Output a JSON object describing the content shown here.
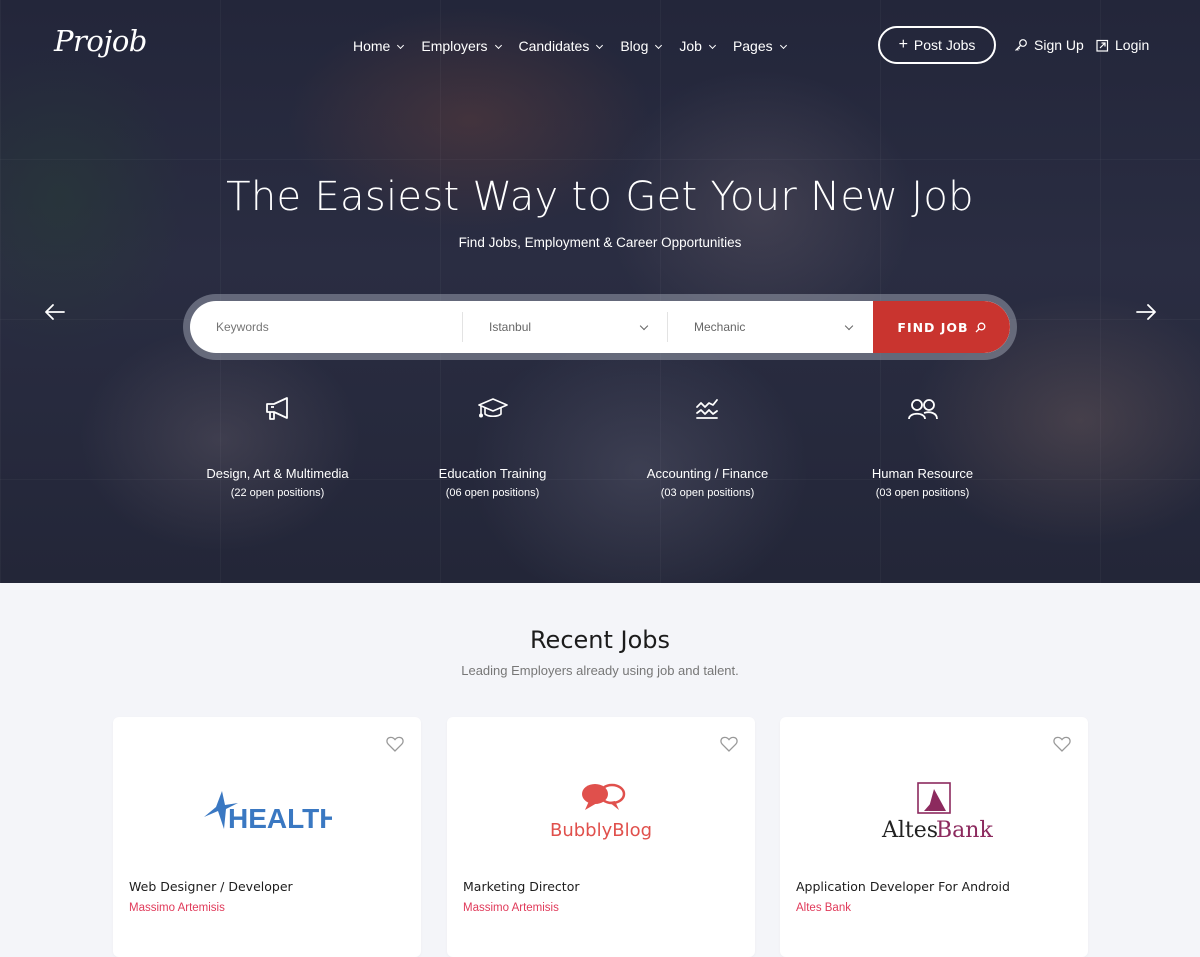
{
  "brand": {
    "logo": "Projob"
  },
  "nav": {
    "items": [
      {
        "label": "Home"
      },
      {
        "label": "Employers"
      },
      {
        "label": "Candidates"
      },
      {
        "label": "Blog"
      },
      {
        "label": "Job"
      },
      {
        "label": "Pages"
      }
    ],
    "post_jobs_label": "Post Jobs",
    "signup_label": "Sign Up",
    "login_label": "Login"
  },
  "hero": {
    "title": "The Easiest Way to Get Your New Job",
    "subtitle": "Find Jobs, Employment & Career Opportunities",
    "search": {
      "keywords_placeholder": "Keywords",
      "keywords_value": "",
      "location_value": "Istanbul",
      "category_value": "Mechanic",
      "button_label": "FIND JOB"
    },
    "categories": [
      {
        "icon": "megaphone-icon",
        "name": "Design, Art & Multimedia",
        "count": "(22 open positions)"
      },
      {
        "icon": "graduation-cap-icon",
        "name": "Education Training",
        "count": "(06 open positions)"
      },
      {
        "icon": "finance-wave-icon",
        "name": "Accounting / Finance",
        "count": "(03 open positions)"
      },
      {
        "icon": "users-icon",
        "name": "Human Resource",
        "count": "(03 open positions)"
      }
    ]
  },
  "recent_jobs": {
    "title": "Recent Jobs",
    "subtitle": "Leading Employers already using job and talent.",
    "jobs": [
      {
        "logo_text": "HEALTH",
        "title": "Web Designer / Developer",
        "company": "Massimo Artemisis"
      },
      {
        "logo_text": "BubblyBlog",
        "title": "Marketing Director",
        "company": "Massimo Artemisis"
      },
      {
        "logo_text_1": "Altes",
        "logo_text_2": "Bank",
        "title": "Application Developer For Android",
        "company": "Altes Bank"
      }
    ]
  },
  "colors": {
    "accent_red": "#c9342f",
    "company_pink": "#e03a5a",
    "hero_bg": "#23263a",
    "health_blue": "#3a78c2",
    "bubbly_red": "#e0504c",
    "altes_purple": "#8c2a5e"
  }
}
